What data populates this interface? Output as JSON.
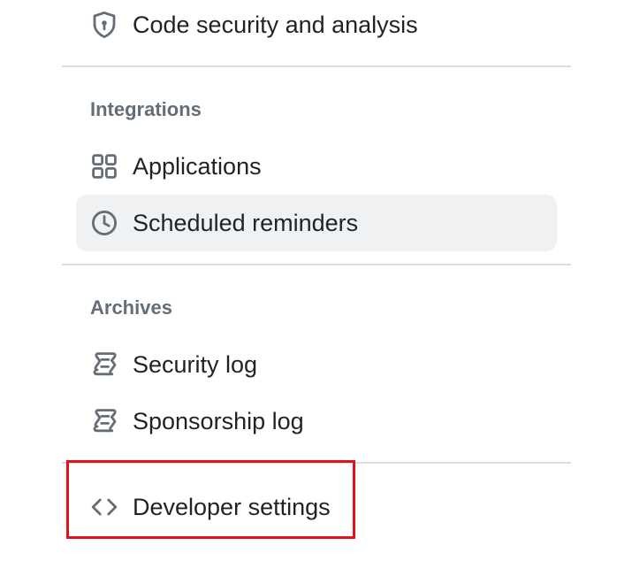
{
  "nav": {
    "code_security": {
      "label": "Code security and analysis",
      "icon": "shield-lock-icon"
    },
    "integrations": {
      "heading": "Integrations",
      "items": [
        {
          "label": "Applications",
          "icon": "apps-icon",
          "selected": false
        },
        {
          "label": "Scheduled reminders",
          "icon": "clock-icon",
          "selected": true
        }
      ]
    },
    "archives": {
      "heading": "Archives",
      "items": [
        {
          "label": "Security log",
          "icon": "log-icon"
        },
        {
          "label": "Sponsorship log",
          "icon": "log-icon"
        }
      ]
    },
    "developer_settings": {
      "label": "Developer settings",
      "icon": "code-icon"
    }
  },
  "colors": {
    "text": "#1f2328",
    "muted": "#656d76",
    "selected_bg": "#eff1f3",
    "divider": "#d8dee4",
    "highlight": "#e3121a"
  }
}
